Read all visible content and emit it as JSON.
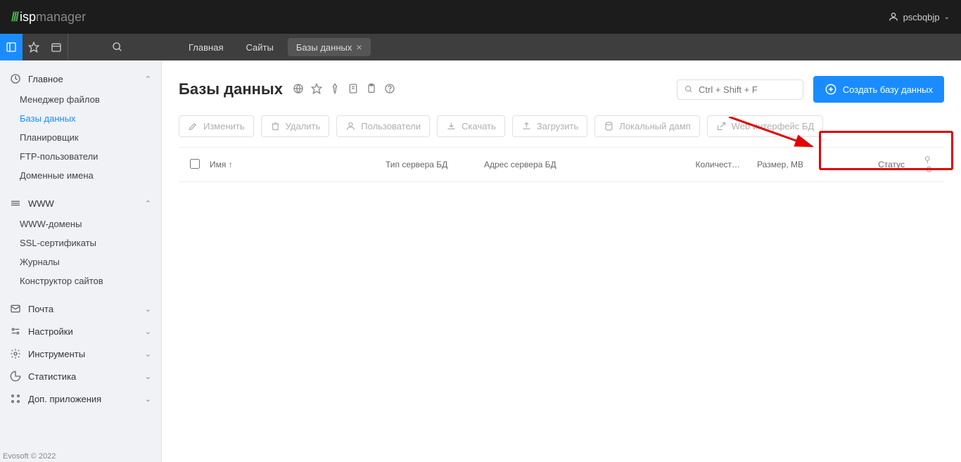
{
  "logo": {
    "isp": "isp",
    "manager": "manager"
  },
  "user": {
    "name": "pscbqbjp"
  },
  "breadcrumbs": {
    "home": "Главная",
    "sites": "Сайты",
    "databases": "Базы данных"
  },
  "sidebar": {
    "sections": [
      {
        "label": "Главное",
        "expanded": true,
        "items": [
          {
            "label": "Менеджер файлов",
            "active": false
          },
          {
            "label": "Базы данных",
            "active": true
          },
          {
            "label": "Планировщик",
            "active": false
          },
          {
            "label": "FTP-пользователи",
            "active": false
          },
          {
            "label": "Доменные имена",
            "active": false
          }
        ]
      },
      {
        "label": "WWW",
        "expanded": true,
        "items": [
          {
            "label": "WWW-домены",
            "active": false
          },
          {
            "label": "SSL-сертификаты",
            "active": false
          },
          {
            "label": "Журналы",
            "active": false
          },
          {
            "label": "Конструктор сайтов",
            "active": false
          }
        ]
      },
      {
        "label": "Почта",
        "expanded": false,
        "items": []
      },
      {
        "label": "Настройки",
        "expanded": false,
        "items": []
      },
      {
        "label": "Инструменты",
        "expanded": false,
        "items": []
      },
      {
        "label": "Статистика",
        "expanded": false,
        "items": []
      },
      {
        "label": "Доп. приложения",
        "expanded": false,
        "items": []
      }
    ]
  },
  "page": {
    "title": "Базы данных",
    "search_placeholder": "Ctrl + Shift + F",
    "create_button": "Создать базу данных"
  },
  "toolbar": {
    "edit": "Изменить",
    "delete": "Удалить",
    "users": "Пользователи",
    "download": "Скачать",
    "upload": "Загрузить",
    "dump": "Локальный дамп",
    "webui": "Web интерфейс БД"
  },
  "columns": {
    "name": "Имя ↑",
    "server_type": "Тип сервера БД",
    "server_addr": "Адрес сервера БД",
    "count": "Количест…",
    "size": "Размер, MB",
    "status": "Статус"
  },
  "rows": [],
  "footer": "Evosoft © 2022",
  "colors": {
    "accent": "#1a8cff",
    "highlight": "#e30000"
  }
}
